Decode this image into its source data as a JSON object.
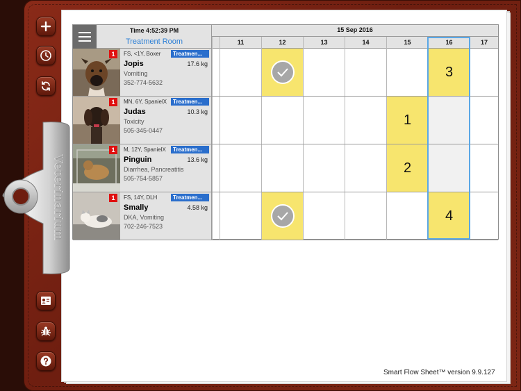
{
  "app": {
    "brand": "Veterinarium",
    "version_text": "Smart Flow Sheet™ version   9.9.127"
  },
  "toolbar": {
    "buttons": [
      {
        "name": "add",
        "icon": "plus-icon"
      },
      {
        "name": "history",
        "icon": "clock-icon"
      },
      {
        "name": "refresh",
        "icon": "refresh-icon"
      },
      {
        "name": "patients",
        "icon": "id-card-icon"
      },
      {
        "name": "bug-report",
        "icon": "bug-icon"
      },
      {
        "name": "help",
        "icon": "help-icon"
      }
    ]
  },
  "header": {
    "time": "Time 4:52:39 PM",
    "room": "Treatment Room",
    "date": "15 Sep 2016",
    "hours": [
      "11",
      "12",
      "13",
      "14",
      "15",
      "16",
      "17"
    ]
  },
  "patients": [
    {
      "signalment": "FS, <1Y, Boxer",
      "tag": "Treatment",
      "tag_short": "Treatmen...",
      "name": "Jopis",
      "weight": "17.6 kg",
      "problem": "Vomiting",
      "phone": "352-774-5632",
      "alert": "1"
    },
    {
      "signalment": "MN, 6Y, SpanielX",
      "tag": "Treatment",
      "tag_short": "Treatmen...",
      "name": "Judas",
      "weight": "10.3 kg",
      "problem": "Toxicity",
      "phone": "505-345-0447",
      "alert": "1"
    },
    {
      "signalment": "M, 12Y, SpanielX",
      "tag": "Treatment",
      "tag_short": "Treatmen...",
      "name": "Pinguin",
      "weight": "13.6 kg",
      "problem": "Diarrhea, Pancreatitis",
      "phone": "505-754-5857",
      "alert": "1"
    },
    {
      "signalment": "FS, 14Y, DLH",
      "tag": "Treatment",
      "tag_short": "Treatmen...",
      "name": "Smally",
      "weight": "4.58 kg",
      "problem": "DKA, Vomiting",
      "phone": "702-246-7523",
      "alert": "1"
    }
  ],
  "tasks": {
    "jopis_12": "done",
    "jopis_16": "3",
    "judas_15": "1",
    "pinguin_15": "2",
    "smally_12": "done",
    "smally_16": "4"
  },
  "colors": {
    "task_yellow": "#f7e56e",
    "current_hour_outline": "#5aa7e6",
    "alert_red": "#e01010",
    "tag_blue": "#2a6ecc",
    "room_link": "#2b7fd6"
  }
}
